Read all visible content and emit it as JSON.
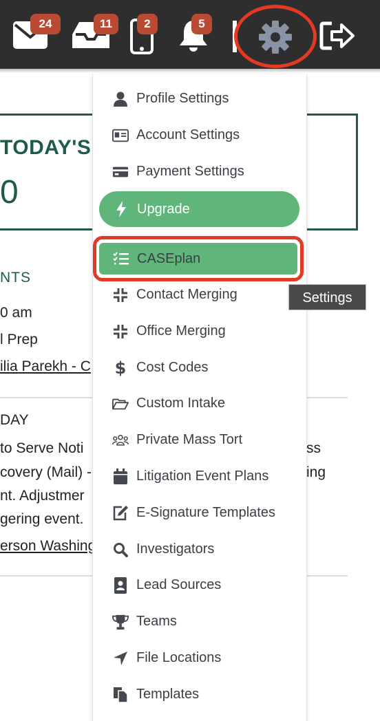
{
  "topbar": {
    "mail_badge": "24",
    "inbox_badge": "11",
    "phone_badge": "2",
    "bell_badge": "5",
    "icons": [
      "envelope-icon",
      "inbox-tray-icon",
      "mobile-phone-icon",
      "bell-icon",
      "gear-icon",
      "sign-out-icon"
    ]
  },
  "background": {
    "today_label": "TODAY'S",
    "today_value": "0",
    "section_events": "NTS",
    "event_time": "0 am",
    "event_title": "l Prep",
    "event_link": "ilia Parekh - C",
    "section_day": "DAY",
    "task_line1": "to Serve Noti",
    "task_line1_right": "ss",
    "task_line2": "covery (Mail) -",
    "task_line2_right": "ing",
    "task_line3": "nt. Adjustmer",
    "task_line4": "gering event.",
    "task_link": "erson Washing"
  },
  "menu": {
    "items": [
      {
        "label": "Profile Settings",
        "icon": "user-icon"
      },
      {
        "label": "Account Settings",
        "icon": "id-card-icon"
      },
      {
        "label": "Payment Settings",
        "icon": "credit-card-icon"
      },
      {
        "label": "Upgrade",
        "icon": "lightning-bolt-icon"
      },
      {
        "label": "CASEplan",
        "icon": "task-list-icon"
      },
      {
        "label": "Contact Merging",
        "icon": "compress-icon"
      },
      {
        "label": "Office Merging",
        "icon": "compress-icon"
      },
      {
        "label": "Cost Codes",
        "icon": "dollar-sign-icon"
      },
      {
        "label": "Custom Intake",
        "icon": "folder-open-icon"
      },
      {
        "label": "Private Mass Tort",
        "icon": "users-group-icon"
      },
      {
        "label": "Litigation Event Plans",
        "icon": "calendar-icon"
      },
      {
        "label": "E-Signature Templates",
        "icon": "edit-icon"
      },
      {
        "label": "Investigators",
        "icon": "search-icon"
      },
      {
        "label": "Lead Sources",
        "icon": "address-book-icon"
      },
      {
        "label": "Teams",
        "icon": "trophy-icon"
      },
      {
        "label": "File Locations",
        "icon": "location-arrow-icon"
      },
      {
        "label": "Templates",
        "icon": "copy-icon"
      }
    ]
  },
  "tooltip": {
    "text": "Settings"
  },
  "colors": {
    "topbar": "#2e2e2e",
    "badge": "#b94a33",
    "highlight_ring": "#e43a25",
    "menu_green": "#5fb57a",
    "brand_dark_green": "#1f5a4c",
    "gear": "#8a93a6"
  }
}
